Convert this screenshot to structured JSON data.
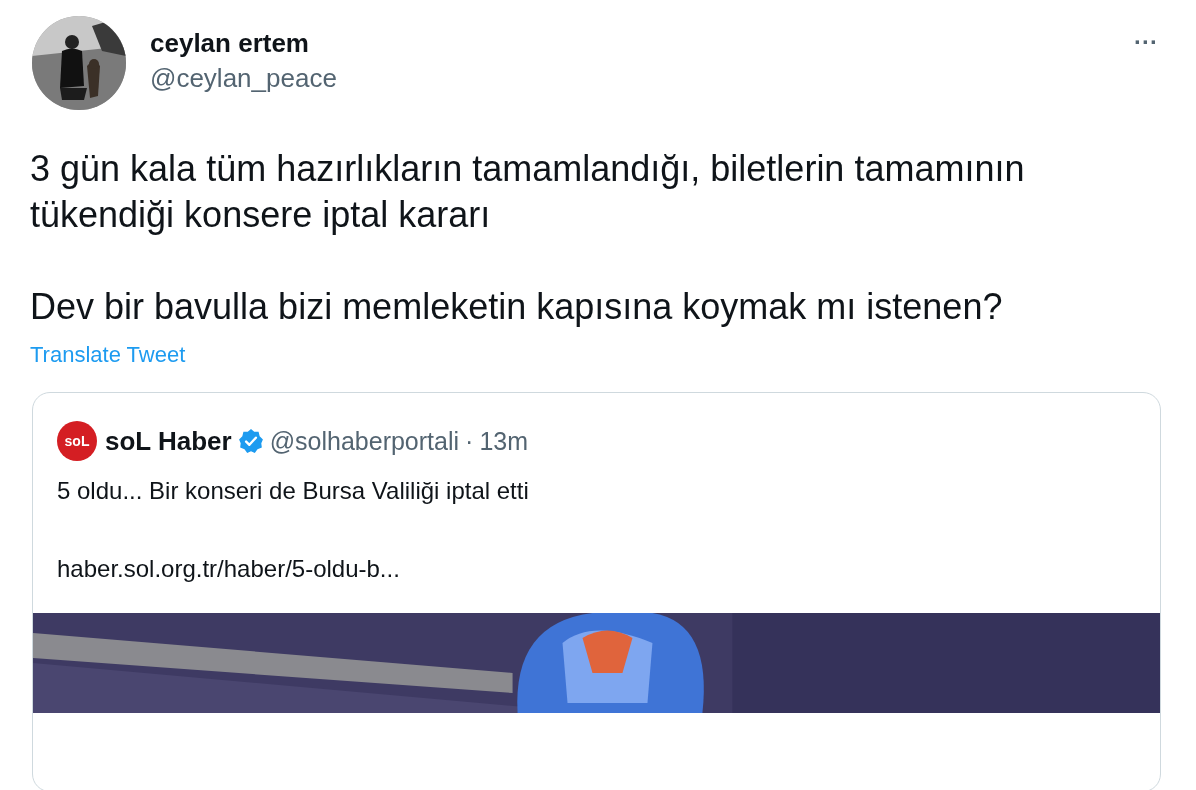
{
  "author": {
    "name": "ceylan ertem",
    "handle": "@ceylan_peace"
  },
  "more": "···",
  "tweet": {
    "paragraphs": [
      "3 gün kala tüm hazırlıkların tamamlandığı, biletlerin tamamının tükendiği konsere iptal kararı",
      "Dev bir bavulla bizi memleketin kapısına koymak mı istenen?"
    ]
  },
  "translate_link": "Translate Tweet",
  "quote": {
    "logo_text": "soL",
    "name": "soL Haber",
    "verified": true,
    "handle": "@solhaberportali",
    "separator": "·",
    "time": "13m",
    "text": "5 oldu... Bir konseri de Bursa Valiliği iptal etti",
    "link": "haber.sol.org.tr/haber/5-oldu-b..."
  }
}
